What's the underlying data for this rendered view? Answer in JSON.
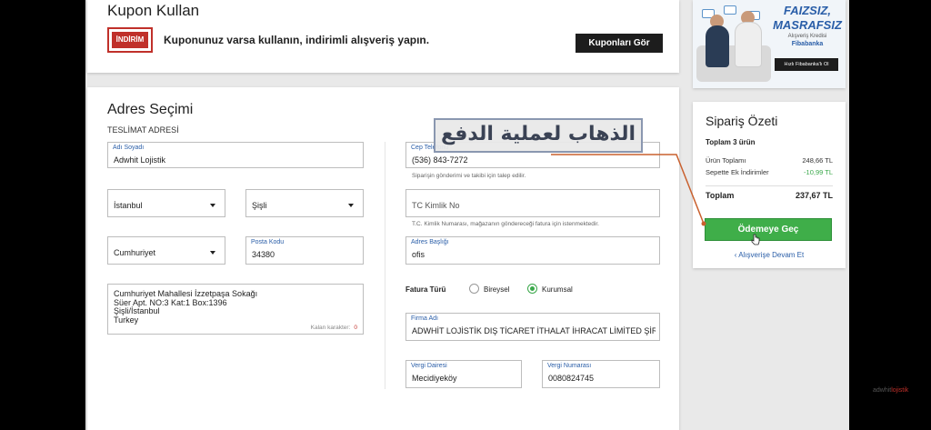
{
  "kupon": {
    "title": "Kupon Kullan",
    "badge": "İNDİRİM",
    "text": "Kuponunuz varsa kullanın, indirimli alışveriş yapın.",
    "button": "Kuponları Gör"
  },
  "ad": {
    "line1": "FAIZSIZ,",
    "line2": "MASRAFSIZ",
    "line3": "Alışveriş Kredisi",
    "brand": "Fibabanka",
    "button": "Hızlı Fibabanka'lı Ol"
  },
  "adres": {
    "title": "Adres Seçimi",
    "section": "TESLİMAT ADRESİ",
    "name_label": "Adı Soyadı",
    "name_value": "Adwhit Lojistik",
    "city": "İstanbul",
    "district": "Şişli",
    "neighborhood": "Cumhuriyet",
    "postal_label": "Posta Kodu",
    "postal_value": "34380",
    "address_lines": [
      "Cumhuriyet Mahallesi İzzetpaşa Sokağı",
      "Süer Apt. NO:3 Kat:1 Box:1396",
      "Şişli/İstanbul",
      "Turkey"
    ],
    "remaining_label": "Kalan karakter:",
    "remaining_value": "0",
    "phone_label": "Cep Telefonu",
    "phone_value": "(536) 843-7272",
    "phone_hint": "Siparişin gönderimi ve takibi için talep edilir.",
    "tc_placeholder": "TC Kimlik No",
    "tc_hint": "T.C. Kimlik Numarası, mağazanın göndereceği fatura için istenmektedir.",
    "title_label": "Adres Başlığı",
    "title_value": "ofis",
    "invoice_type_label": "Fatura Türü",
    "option_individual": "Bireysel",
    "option_corporate": "Kurumsal",
    "company_label": "Firma Adı",
    "company_value": "ADWHİT LOJİSTİK DIŞ TİCARET İTHALAT İHRACAT LİMİTED ŞİRKETİ",
    "tax_office_label": "Vergi Dairesi",
    "tax_office_value": "Mecidiyeköy",
    "tax_no_label": "Vergi Numarası",
    "tax_no_value": "0080824745"
  },
  "overlay": {
    "text": "الذهاب لعملية الدفع"
  },
  "summary": {
    "title": "Sipariş Özeti",
    "count": "Toplam 3 ürün",
    "rows": [
      {
        "label": "Ürün Toplamı",
        "value": "248,66 TL"
      },
      {
        "label": "Sepette Ek İndirimler",
        "value": "-10,99 TL"
      }
    ],
    "total_label": "Toplam",
    "total_value": "237,67 TL",
    "pay_button": "Ödemeye Geç",
    "continue_link": "‹  Alışverişe Devam Et"
  },
  "watermark": {
    "prefix": "adwhit",
    "suffix": "lojistik"
  },
  "colors": {
    "pay_green": "#3fae49",
    "discount_green": "#3aa84a",
    "brand_red": "#c0302a",
    "link_blue": "#2a5ea8"
  }
}
